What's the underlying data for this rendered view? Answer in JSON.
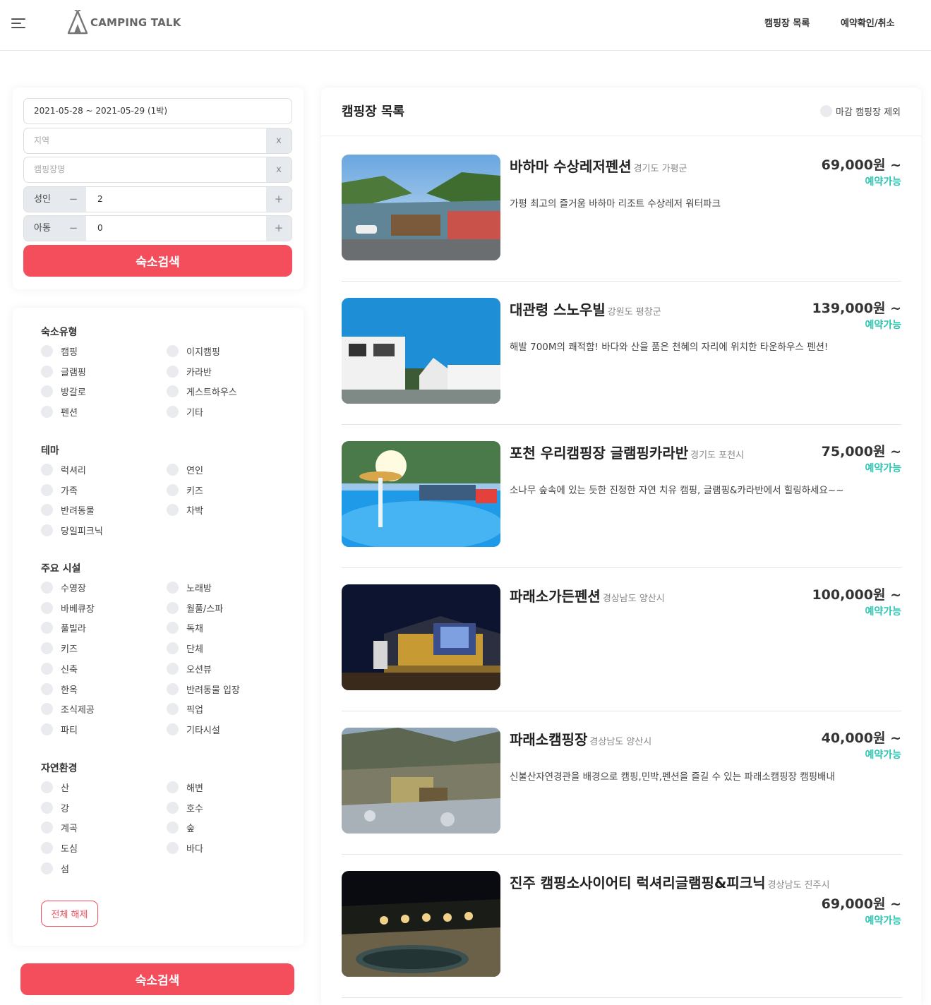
{
  "header": {
    "logo_text": "CAMPING TALK",
    "nav": [
      "캠핑장 목록",
      "예약확인/취소"
    ]
  },
  "search": {
    "date_range": "2021-05-28 ~ 2021-05-29 (1박)",
    "region_placeholder": "지역",
    "name_placeholder": "캠핑장명",
    "clear_label": "x",
    "adult_label": "성인",
    "adult_value": "2",
    "child_label": "아동",
    "child_value": "0",
    "minus_label": "−",
    "plus_label": "+",
    "search_button": "숙소검색"
  },
  "filters": {
    "groups": [
      {
        "title": "숙소유형",
        "options": [
          "캠핑",
          "이지캠핑",
          "글램핑",
          "카라반",
          "방갈로",
          "게스트하우스",
          "펜션",
          "기타"
        ]
      },
      {
        "title": "테마",
        "options": [
          "럭셔리",
          "연인",
          "가족",
          "키즈",
          "반려동물",
          "차박",
          "당일피크닉"
        ]
      },
      {
        "title": "주요 시설",
        "options": [
          "수영장",
          "노래방",
          "바베큐장",
          "월풀/스파",
          "풀빌라",
          "독채",
          "키즈",
          "단체",
          "신축",
          "오션뷰",
          "한옥",
          "반려동물 입장",
          "조식제공",
          "픽업",
          "파티",
          "기타시설"
        ]
      },
      {
        "title": "자연환경",
        "options": [
          "산",
          "해변",
          "강",
          "호수",
          "계곡",
          "숲",
          "도심",
          "바다",
          "섬"
        ]
      }
    ],
    "reset_button": "전체 해제"
  },
  "bottom_search_button": "숙소검색",
  "list": {
    "title": "캠핑장 목록",
    "exclude_closed": "마감 캠핑장 제외",
    "items": [
      {
        "name": "바하마 수상레저펜션",
        "region": "경기도 가평군",
        "price": "69,000원 ~",
        "status": "예약가능",
        "desc": "가평 최고의 즐거움 바하마 리조트 수상레저 워터파크"
      },
      {
        "name": "대관령 스노우빌",
        "region": "강원도 평창군",
        "price": "139,000원 ~",
        "status": "예약가능",
        "desc": "해발 700M의 쾌적함! 바다와 산을 품은 천혜의 자리에 위치한 타운하우스 펜션!"
      },
      {
        "name": "포천 우리캠핑장 글램핑카라반",
        "region": "경기도 포천시",
        "price": "75,000원 ~",
        "status": "예약가능",
        "desc": "소나무 숲속에 있는 듯한 진정한 자연 치유 캠핑, 글램핑&카라반에서 힐링하세요~~"
      },
      {
        "name": "파래소가든펜션",
        "region": "경상남도 양산시",
        "price": "100,000원 ~",
        "status": "예약가능",
        "desc": ""
      },
      {
        "name": "파래소캠핑장",
        "region": "경상남도 양산시",
        "price": "40,000원 ~",
        "status": "예약가능",
        "desc": "신불산자연경관을 배경으로 캠핑,민박,펜션을 즐길 수 있는 파래소캠핑장 캠핑배내"
      },
      {
        "name": "진주 캠핑소사이어티 럭셔리글램핑&피크닉",
        "region": "경상남도 진주시",
        "price": "69,000원 ~",
        "status": "예약가능",
        "desc": ""
      }
    ]
  },
  "colors": {
    "accent": "#f44e5c",
    "available": "#2cc6b2"
  },
  "icons": [
    "menu-icon",
    "tent-logo-icon"
  ]
}
